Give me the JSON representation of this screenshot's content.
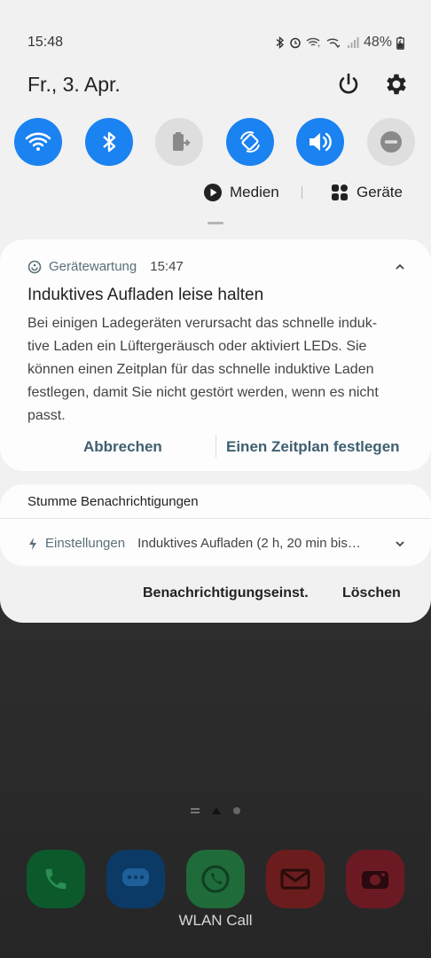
{
  "status_bar": {
    "time": "15:48",
    "battery": "48%",
    "icons": [
      "bluetooth-icon",
      "alarm-icon",
      "wifi-call-icon",
      "vowifi-icon",
      "signal-icon",
      "battery-charging-icon"
    ]
  },
  "header": {
    "date": "Fr., 3. Apr.",
    "icons": [
      "power-icon",
      "gear-icon"
    ]
  },
  "quick_settings": [
    {
      "icon": "wifi-icon",
      "state": "on"
    },
    {
      "icon": "bluetooth-icon",
      "state": "on"
    },
    {
      "icon": "power-share-icon",
      "state": "off"
    },
    {
      "icon": "auto-rotate-icon",
      "state": "on"
    },
    {
      "icon": "sound-icon",
      "state": "on"
    },
    {
      "icon": "do-not-disturb-icon",
      "state": "off"
    }
  ],
  "media_row": {
    "media_label": "Medien",
    "devices_label": "Geräte"
  },
  "notification": {
    "app": "Gerätewartung",
    "time": "15:47",
    "title": "Induktives Aufladen leise halten",
    "body_lines": [
      "Bei einigen Ladegeräten verursacht das schnelle induk-",
      "tive Laden ein Lüftergeräusch oder aktiviert LEDs. Sie",
      "können einen Zeitplan für das schnelle induktive Laden",
      "festlegen, damit Sie nicht gestört werden, wenn es nicht",
      "passt."
    ],
    "action_cancel": "Abbrechen",
    "action_schedule": "Einen Zeitplan festlegen"
  },
  "silent": {
    "heading": "Stumme Benachrichtigungen",
    "app": "Einstellungen",
    "text": "Induktives Aufladen (2 h, 20 min bis…"
  },
  "footer": {
    "settings_label": "Benachrichtigungseinst.",
    "clear_label": "Löschen"
  },
  "home": {
    "dock_label": "WLAN Call",
    "dock_apps": [
      "phone-icon",
      "messages-icon",
      "whatsapp-icon",
      "email-icon",
      "camera-icon"
    ],
    "colors": {
      "phone": "#0c5a2c",
      "messages": "#0c3a66",
      "whatsapp": "#1f6b3a",
      "email": "#6b1d1d",
      "camera": "#6b1a23"
    }
  },
  "colors": {
    "accent": "#1b82f1",
    "tile_off": "#dedede",
    "shade_bg": "#f1f1f1",
    "card_bg": "#fdfdfd"
  }
}
